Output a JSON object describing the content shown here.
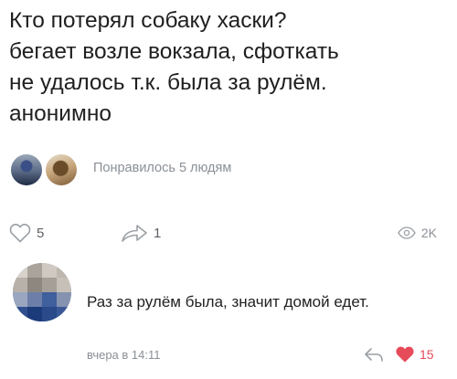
{
  "post": {
    "lines": [
      "Кто потерял собаку хаски?",
      "бегает возле вокзала, сфоткать",
      "не удалось т.к. была за рулём.",
      "анонимно"
    ],
    "likes_text": "Понравилось 5 людям"
  },
  "actions": {
    "like_count": "5",
    "share_count": "1",
    "views_count": "2K"
  },
  "comment": {
    "text": "Раз за рулём была, значит домой едет.",
    "time": "вчера в 14:11",
    "like_count": "15"
  },
  "colors": {
    "like_red": "#e64b5a",
    "muted_gray": "#8a8f96",
    "icon_gray": "#9aa0a6"
  },
  "icons": [
    "heart-icon",
    "share-icon",
    "eye-icon",
    "reply-icon",
    "heart-filled-icon"
  ]
}
